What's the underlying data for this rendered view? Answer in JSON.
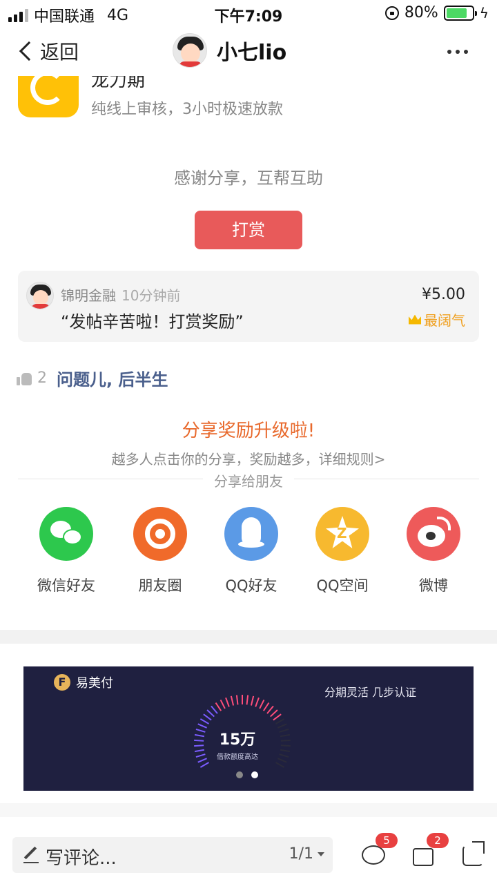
{
  "status_bar": {
    "carrier": "中国联通",
    "network": "4G",
    "time": "下午7:09",
    "battery_text": "80%",
    "battery_level": 0.8,
    "accent_color": "#4cd964"
  },
  "nav": {
    "back_label": "返回",
    "title": "小七lio"
  },
  "app_card": {
    "name": "龙力期",
    "subtitle": "纯线上审核，3小时极速放款"
  },
  "reward": {
    "thanks_text": "感谢分享，互帮互助",
    "button_label": "打赏",
    "button_color": "#e85a5a"
  },
  "tip": {
    "user": "锦明金融",
    "time": "10分钟前",
    "message": "“发帖辛苦啦！打赏奖励”",
    "amount": "¥5.00",
    "badge": "最阔气"
  },
  "likes": {
    "count": "2",
    "users": "问题儿, 后半生"
  },
  "share": {
    "title": "分享奖励升级啦!",
    "subtitle": "越多人点击你的分享，奖励越多，详细规则>",
    "divider_label": "分享给朋友",
    "items": [
      {
        "label": "微信好友",
        "icon": "wechat-icon",
        "color": "#2dc84d"
      },
      {
        "label": "朋友圈",
        "icon": "moments-icon",
        "color": "#f06a2a"
      },
      {
        "label": "QQ好友",
        "icon": "qq-icon",
        "color": "#5b9ae6"
      },
      {
        "label": "QQ空间",
        "icon": "qzone-icon",
        "color": "#f7b92f"
      },
      {
        "label": "微博",
        "icon": "weibo-icon",
        "color": "#ee5a5a"
      }
    ]
  },
  "banner": {
    "brand": "易美付",
    "tagline": "分期灵活 几步认证",
    "amount": "15万",
    "caption": "借款额度高达",
    "background": "#1f2040"
  },
  "bottom_bar": {
    "comment_placeholder": "写评论...",
    "page_indicator": "1/1",
    "comment_count": "5",
    "like_count": "2"
  }
}
